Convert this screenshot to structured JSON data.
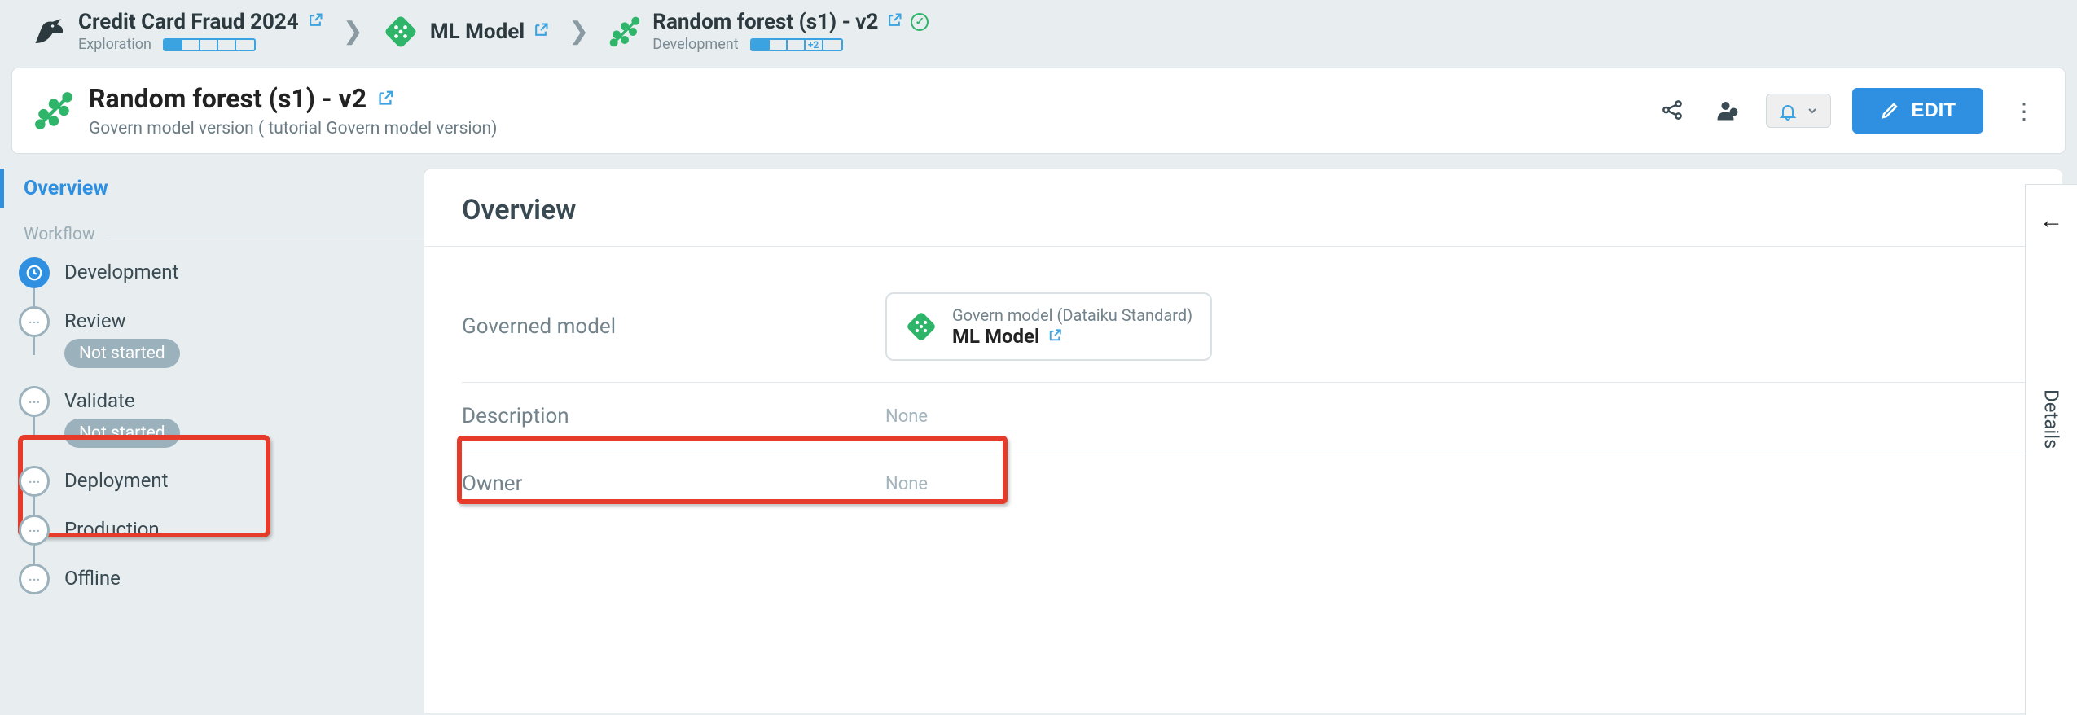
{
  "breadcrumb": [
    {
      "title": "Credit Card Fraud 2024",
      "sublabel": "Exploration",
      "icon": "bird",
      "status_segments": 5,
      "status_filled": 1
    },
    {
      "title": "ML Model",
      "icon": "dice"
    },
    {
      "title": "Random forest (s1) - v2",
      "sublabel": "Development",
      "icon": "tree",
      "checked": true,
      "status_segments": 5,
      "status_filled": 1,
      "status_badge": "+2"
    }
  ],
  "page": {
    "title": "Random forest (s1) - v2",
    "subtitle": "Govern model version (        tutorial Govern model version)"
  },
  "actions": {
    "edit_label": "EDIT"
  },
  "sidebar": {
    "overview_label": "Overview",
    "workflow_header": "Workflow",
    "items": [
      {
        "label": "Development",
        "status": null,
        "active": true
      },
      {
        "label": "Review",
        "status": "Not started",
        "active": false
      },
      {
        "label": "Validate",
        "status": "Not started",
        "active": false
      },
      {
        "label": "Deployment",
        "status": null,
        "active": false
      },
      {
        "label": "Production",
        "status": null,
        "active": false
      },
      {
        "label": "Offline",
        "status": null,
        "active": false
      }
    ]
  },
  "overview": {
    "heading": "Overview",
    "fields": {
      "governed_model_label": "Governed model",
      "governed_model_chip_top": "Govern model (Dataiku Standard)",
      "governed_model_chip_bot": "ML Model",
      "description_label": "Description",
      "description_value": "None",
      "owner_label": "Owner",
      "owner_value": "None"
    }
  },
  "right_rail": {
    "label": "Details"
  }
}
